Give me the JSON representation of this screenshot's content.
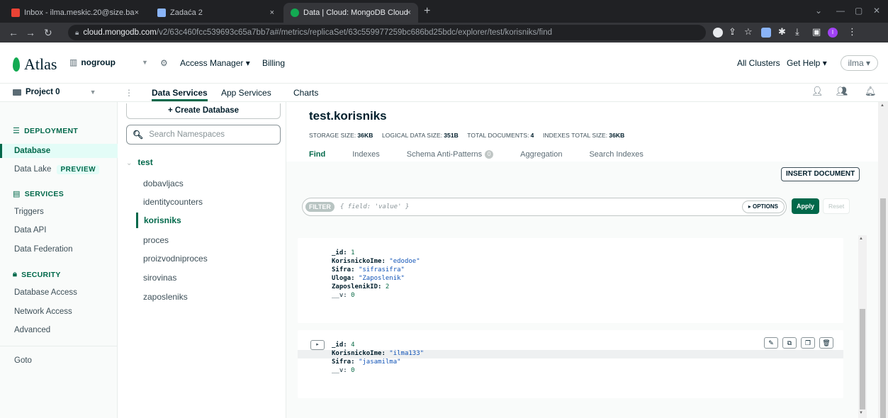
{
  "browser": {
    "tabs": [
      {
        "label": "Inbox - ilma.meskic.20@size.ba",
        "close": "×"
      },
      {
        "label": "Zadaća 2",
        "close": "×"
      },
      {
        "label": "Data | Cloud: MongoDB Cloud",
        "close": "×"
      }
    ],
    "new_tab": "+",
    "url_host": "cloud.mongodb.com",
    "url_path": "/v2/63c460fcc539693c65a7bb7a#/metrics/replicaSet/63c559977259bc686bd25bdc/explorer/test/korisniks/find",
    "profile_initial": "I"
  },
  "atlas": {
    "logo": "Atlas",
    "org": "nogroup",
    "access_manager": "Access Manager ▾",
    "billing": "Billing",
    "all_clusters": "All Clusters",
    "get_help": "Get Help ▾",
    "user": "ilma ▾"
  },
  "project": {
    "name": "Project 0",
    "tabs": [
      "Data Services",
      "App Services",
      "Charts"
    ]
  },
  "sidebar": {
    "deployment": "DEPLOYMENT",
    "database": "Database",
    "data_lake": "Data Lake",
    "preview": "PREVIEW",
    "services": "SERVICES",
    "triggers": "Triggers",
    "data_api": "Data API",
    "data_federation": "Data Federation",
    "security": "SECURITY",
    "database_access": "Database Access",
    "network_access": "Network Access",
    "advanced": "Advanced",
    "goto": "Goto"
  },
  "namespaces": {
    "create_db": "+ Create Database",
    "search_placeholder": "Search Namespaces",
    "db": "test",
    "collections": [
      "dobavljacs",
      "identitycounters",
      "korisniks",
      "proces",
      "proizvodniproces",
      "sirovinas",
      "zaposleniks"
    ]
  },
  "main": {
    "title": "test.korisniks",
    "stats": {
      "storage_label": "STORAGE SIZE:",
      "storage": "36KB",
      "logical_label": "LOGICAL DATA SIZE:",
      "logical": "351B",
      "docs_label": "TOTAL DOCUMENTS:",
      "docs": "4",
      "indexes_label": "INDEXES TOTAL SIZE:",
      "indexes": "36KB"
    },
    "tabs": [
      "Find",
      "Indexes",
      "Schema Anti-Patterns",
      "Aggregation",
      "Search Indexes"
    ],
    "antipatterns_count": "0",
    "insert": "INSERT DOCUMENT",
    "filter_pill": "FILTER",
    "filter_placeholder": "{ field: 'value' }",
    "options": "▸ OPTIONS",
    "apply": "Apply",
    "reset": "Reset"
  },
  "documents": [
    {
      "fields": [
        {
          "key": "_id:",
          "val": "1",
          "type": "n"
        },
        {
          "key": "KorisnickoIme:",
          "val": "\"edodoe\"",
          "type": "s"
        },
        {
          "key": "Sifra:",
          "val": "\"sifrasifra\"",
          "type": "s"
        },
        {
          "key": "Uloga:",
          "val": "\"Zaposlenik\"",
          "type": "s"
        },
        {
          "key": "ZaposlenikID:",
          "val": "2",
          "type": "n"
        },
        {
          "key": "__v:",
          "val": "0",
          "type": "n"
        }
      ]
    },
    {
      "fields": [
        {
          "key": "_id:",
          "val": "4",
          "type": "n"
        },
        {
          "key": "KorisnickoIme:",
          "val": "\"ilma133\"",
          "type": "s"
        },
        {
          "key": "Sifra:",
          "val": "\"jasamilma\"",
          "type": "s"
        },
        {
          "key": "__v:",
          "val": "0",
          "type": "n"
        }
      ]
    }
  ],
  "colors": {
    "brand": "#00684a",
    "accent": "#13aa52"
  }
}
